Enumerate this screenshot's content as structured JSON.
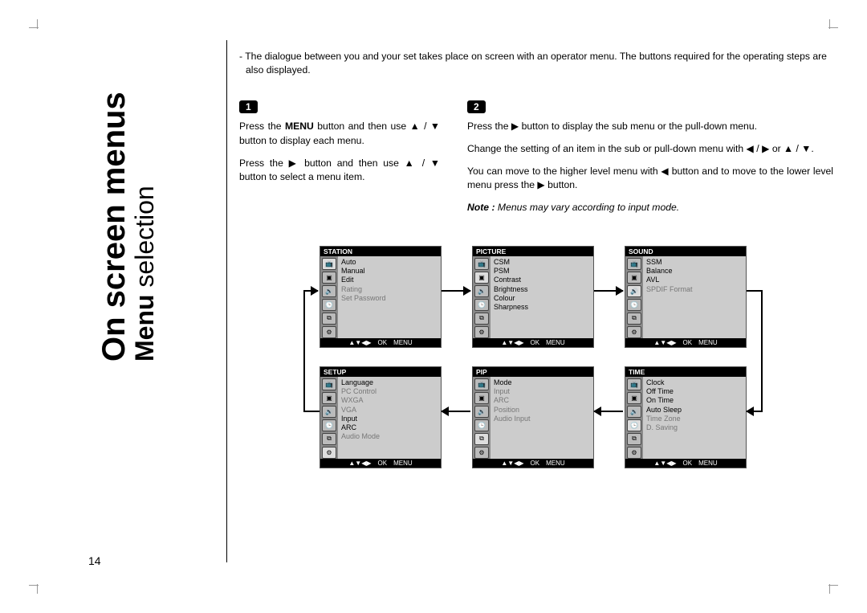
{
  "title_main": "On screen menus",
  "title_sub_bold": "Menu",
  "title_sub_light": " selection",
  "page_number": "14",
  "intro": "The dialogue between you and your set takes place on screen with an operator menu. The buttons required for the operating steps are also displayed.",
  "step1": {
    "num": "1",
    "p1a": "Press the ",
    "p1b": "MENU",
    "p1c": " button and then use ▲ / ▼ button to display each menu.",
    "p2": "Press the ▶ button and then use ▲ / ▼ button to select a menu item."
  },
  "step2": {
    "num": "2",
    "p1": "Press the ▶ button to display the sub menu or the pull-down menu.",
    "p2": "Change the setting of an item in the sub or pull-down menu with ◀ / ▶ or ▲ / ▼.",
    "p3": "You can move to the higher level menu with ◀ button and to move to the lower level menu press the ▶ button."
  },
  "note_label": "Note : ",
  "note_text": "Menus may vary according to input mode.",
  "footer_nav": "▲▼◀▶",
  "footer_ok": "OK",
  "footer_menu": "MENU",
  "menus": {
    "station": {
      "title": "STATION",
      "items": [
        {
          "label": "Auto",
          "dim": false
        },
        {
          "label": "Manual",
          "dim": false
        },
        {
          "label": "Edit",
          "dim": false
        },
        {
          "label": "Rating",
          "dim": true
        },
        {
          "label": "Set Password",
          "dim": true
        }
      ],
      "selected_icon": 0
    },
    "picture": {
      "title": "PICTURE",
      "items": [
        {
          "label": "CSM",
          "dim": false
        },
        {
          "label": "PSM",
          "dim": false
        },
        {
          "label": "Contrast",
          "dim": false
        },
        {
          "label": "Brightness",
          "dim": false
        },
        {
          "label": "Colour",
          "dim": false
        },
        {
          "label": "Sharpness",
          "dim": false
        }
      ],
      "selected_icon": 1
    },
    "sound": {
      "title": "SOUND",
      "items": [
        {
          "label": "SSM",
          "dim": false
        },
        {
          "label": "Balance",
          "dim": false
        },
        {
          "label": "AVL",
          "dim": false
        },
        {
          "label": "SPDIF Format",
          "dim": true
        }
      ],
      "selected_icon": 2
    },
    "time": {
      "title": "TIME",
      "items": [
        {
          "label": "Clock",
          "dim": false
        },
        {
          "label": "Off Time",
          "dim": false
        },
        {
          "label": "On Time",
          "dim": false
        },
        {
          "label": "Auto Sleep",
          "dim": false
        },
        {
          "label": "Time Zone",
          "dim": true
        },
        {
          "label": "D. Saving",
          "dim": true
        }
      ],
      "selected_icon": 3
    },
    "pip": {
      "title": "PIP",
      "items": [
        {
          "label": "Mode",
          "dim": false
        },
        {
          "label": "Input",
          "dim": true
        },
        {
          "label": "ARC",
          "dim": true
        },
        {
          "label": "Position",
          "dim": true
        },
        {
          "label": "Audio Input",
          "dim": true
        }
      ],
      "selected_icon": 4
    },
    "setup": {
      "title": "SETUP",
      "items": [
        {
          "label": "Language",
          "dim": false
        },
        {
          "label": "PC Control",
          "dim": true
        },
        {
          "label": "WXGA",
          "dim": true
        },
        {
          "label": "VGA",
          "dim": true
        },
        {
          "label": "Input",
          "dim": false
        },
        {
          "label": "ARC",
          "dim": false
        },
        {
          "label": "Audio Mode",
          "dim": true
        }
      ],
      "selected_icon": 5
    }
  },
  "icon_glyphs": [
    "📺",
    "▣",
    "🔊",
    "🕒",
    "⧉",
    "⚙"
  ]
}
